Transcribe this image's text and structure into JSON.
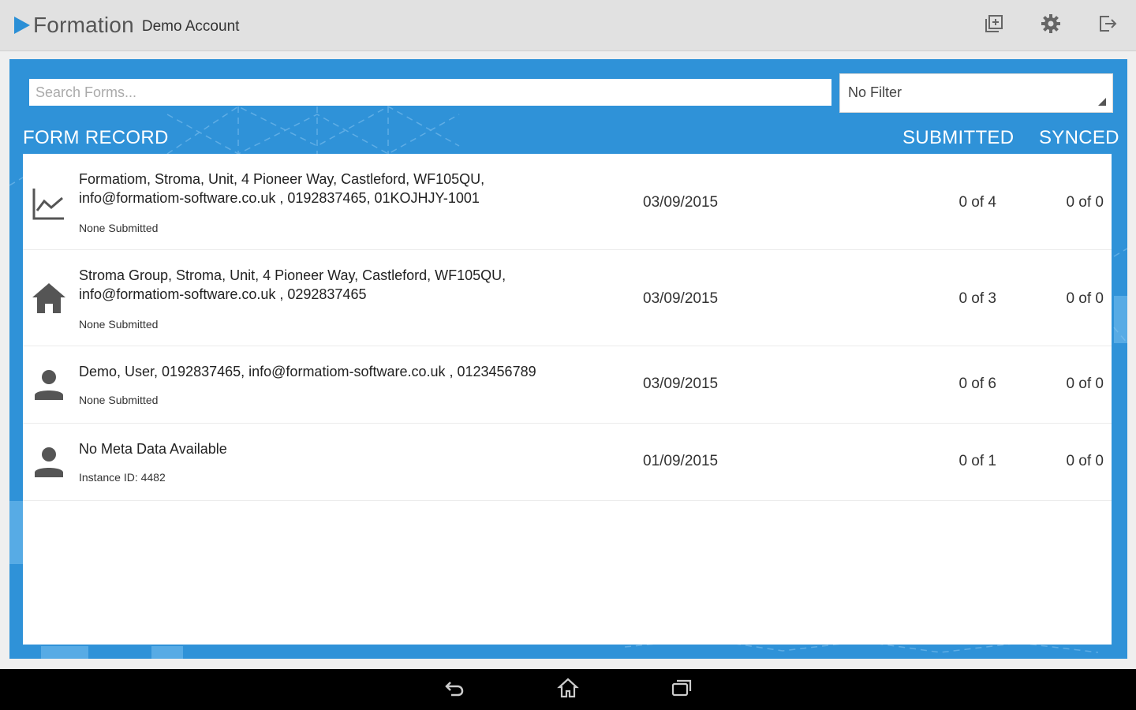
{
  "app": {
    "name": "Formation",
    "account": "Demo Account",
    "brand_color": "#2a8fd6"
  },
  "toolbar": {
    "icons": [
      "add-form-icon",
      "settings-gear-icon",
      "logout-icon"
    ]
  },
  "search": {
    "placeholder": "Search Forms...",
    "value": ""
  },
  "filter": {
    "selected": "No Filter"
  },
  "columns": {
    "record": "FORM RECORD",
    "submitted": "SUBMITTED",
    "synced": "SYNCED"
  },
  "records": [
    {
      "icon": "chart-icon",
      "title": "Formatiom, Stroma, Unit, 4 Pioneer Way, Castleford, WF105QU, info@formatiom-software.co.uk , 0192837465, 01KOJHJY-1001",
      "subtitle": "None Submitted",
      "date": "03/09/2015",
      "submitted": "0 of 4",
      "synced": "0 of 0"
    },
    {
      "icon": "home-icon",
      "title": "Stroma Group, Stroma, Unit, 4 Pioneer Way, Castleford, WF105QU, info@formatiom-software.co.uk , 0292837465",
      "subtitle": "None Submitted",
      "date": "03/09/2015",
      "submitted": "0 of 3",
      "synced": "0 of 0"
    },
    {
      "icon": "person-icon",
      "title": "Demo, User, 0192837465, info@formatiom-software.co.uk , 0123456789",
      "subtitle": "None Submitted",
      "date": "03/09/2015",
      "submitted": "0 of 6",
      "synced": "0 of 0"
    },
    {
      "icon": "person-icon",
      "title": "No Meta Data Available",
      "subtitle": "Instance ID: 4482",
      "date": "01/09/2015",
      "submitted": "0 of 1",
      "synced": "0 of 0"
    }
  ],
  "navbar": {
    "icons": [
      "back-icon",
      "home-nav-icon",
      "recent-apps-icon"
    ]
  }
}
